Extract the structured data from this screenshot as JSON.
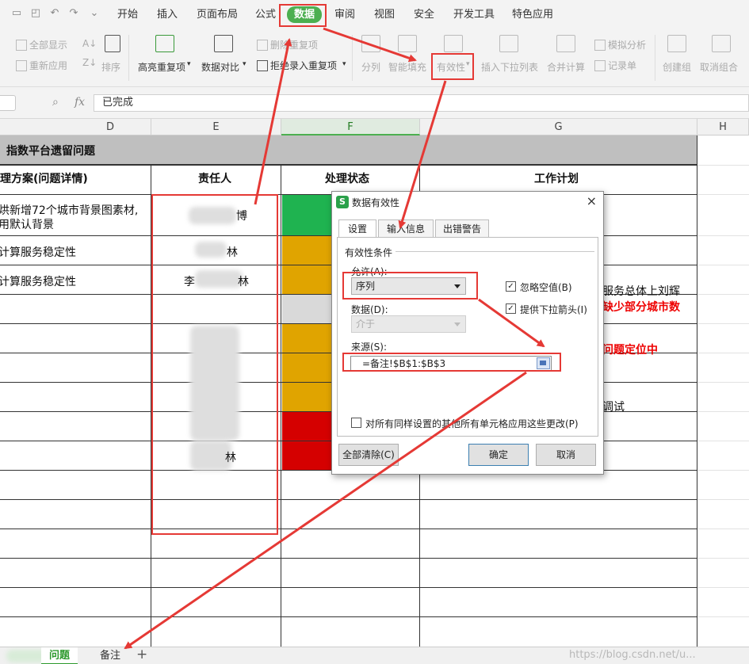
{
  "menubar": {
    "tabs": [
      "开始",
      "插入",
      "页面布局",
      "公式",
      "数据",
      "审阅",
      "视图",
      "安全",
      "开发工具",
      "特色应用"
    ],
    "active_tab": "数据",
    "active_color": "#4caf50"
  },
  "ribbon": {
    "show_all": "全部显示",
    "reapply": "重新应用",
    "sort": "排序",
    "highlight_dup": "高亮重复项",
    "compare": "数据对比",
    "remove_dup": "删除重复项",
    "reject_dup": "拒绝录入重复项",
    "split": "分列",
    "smart_fill": "智能填充",
    "validation": "有效性",
    "dropdown": "插入下拉列表",
    "consolidate": "合并计算",
    "whatif": "模拟分析",
    "record": "记录单",
    "group": "创建组",
    "ungroup": "取消组合"
  },
  "formula_bar": {
    "fx": "fx",
    "value": "已完成"
  },
  "columns": {
    "D": "D",
    "E": "E",
    "F": "F",
    "G": "G",
    "H": "H"
  },
  "sheet": {
    "title": "指数平台遗留问题",
    "header_solution": "理方案(问题详情)",
    "header_owner": "责任人",
    "header_status": "处理状态",
    "header_plan": "工作计划",
    "row1_line1": "烘新增72个城市背景图素材,",
    "row1_line2": "用默认背景",
    "row1_owner_suffix": "博",
    "row2": "计算服务稳定性",
    "row2_owner_suffix": "林",
    "row3": "计算服务稳定性",
    "row3_owner_prefix": "李",
    "row3_owner_suffix": "林",
    "row9_owner_suffix": "林",
    "plan_line1": "服务总体上刘辉",
    "plan_line2": "缺少部分城市数",
    "plan_line3": "问题定位中",
    "plan_line4": "调试",
    "status_colors": [
      "#1fb350",
      "#e0a400",
      "#e0a400",
      "#d9d9d9",
      "#e0a400",
      "#e0a400",
      "#e0a400",
      "#d50000",
      "#d50000"
    ]
  },
  "sheet_tabs": {
    "active": "问题",
    "other": "备注",
    "add": "+",
    "watermark": "https://blog.csdn.net/u..."
  },
  "dialog": {
    "title": "数据有效性",
    "close": "×",
    "tabs": [
      "设置",
      "输入信息",
      "出错警告"
    ],
    "group": "有效性条件",
    "allow_label": "允许(A):",
    "allow_value": "序列",
    "data_label": "数据(D):",
    "data_value": "介于",
    "ignore_blank": "忽略空值(B)",
    "dropdown_arrow": "提供下拉箭头(I)",
    "source_label": "来源(S):",
    "source_value": "=备注!$B$1:$B$3",
    "apply_all": "对所有同样设置的其他所有单元格应用这些更改(P)",
    "clear_all": "全部清除(C)",
    "ok": "确定",
    "cancel": "取消"
  }
}
